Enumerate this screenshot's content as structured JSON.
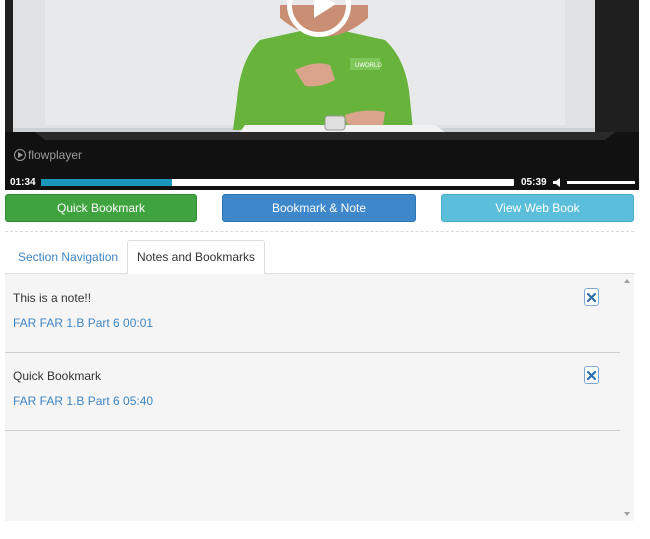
{
  "player": {
    "logo_text": "flowplayer",
    "elapsed": "01:34",
    "duration": "05:39",
    "progress_fraction": 0.277,
    "volume_fraction": 1.0,
    "shirt_logo": "UWORLD"
  },
  "actions": {
    "quick_bookmark": "Quick Bookmark",
    "bookmark_note": "Bookmark & Note",
    "view_web_book": "View Web Book"
  },
  "tabs": [
    {
      "label": "Section Navigation",
      "active": false
    },
    {
      "label": "Notes and Bookmarks",
      "active": true
    }
  ],
  "notes": [
    {
      "title": "This is a note!!",
      "link": "FAR FAR 1.B Part 6 00:01"
    },
    {
      "title": "Quick Bookmark",
      "link": "FAR FAR 1.B Part 6 05:40"
    }
  ],
  "colors": {
    "green": "#3fa33f",
    "blue": "#3d87ca",
    "cyan": "#5bbfdc",
    "progress": "#1b97bb",
    "link": "#3f86c3"
  }
}
